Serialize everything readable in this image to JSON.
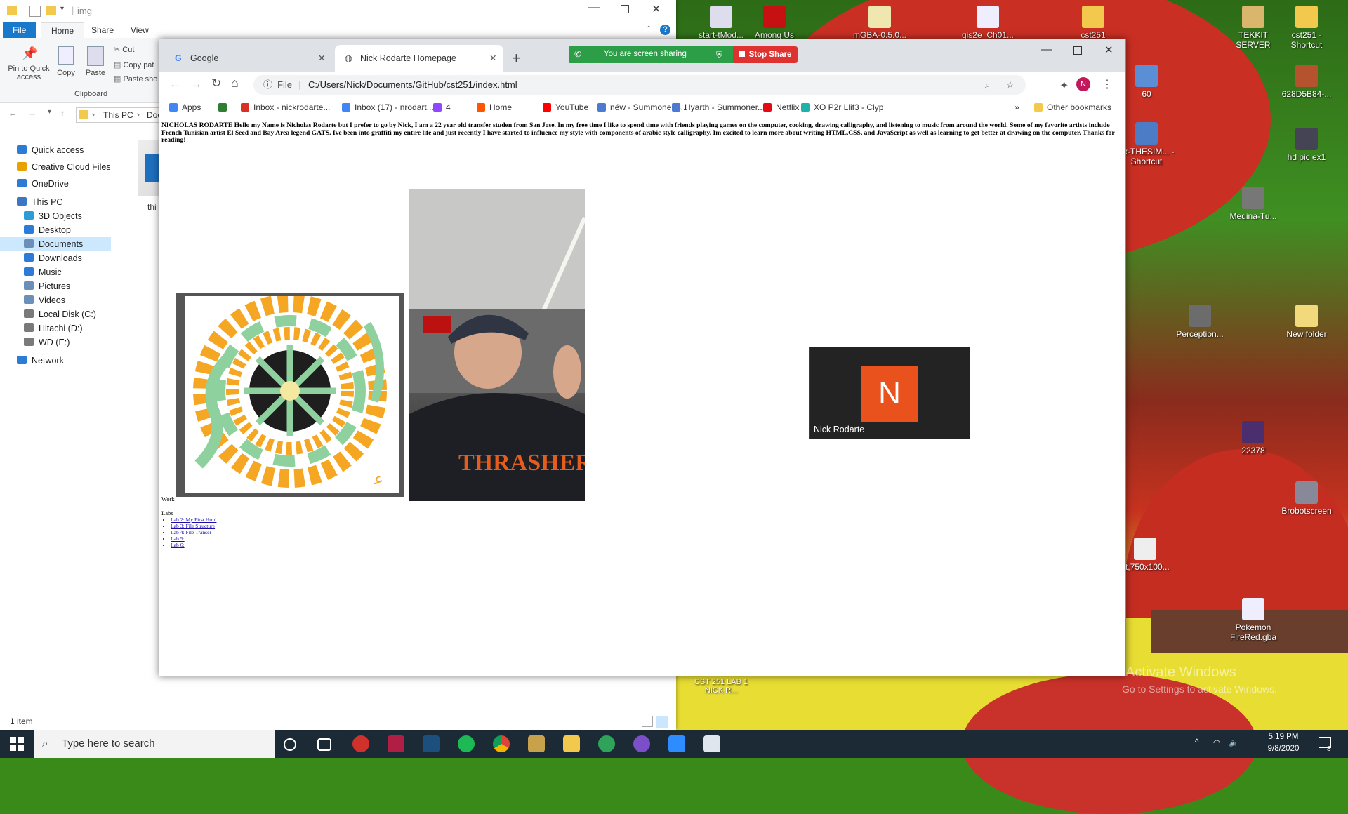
{
  "explorer": {
    "path_title": "img",
    "tabs": [
      "File",
      "Home",
      "Share",
      "View"
    ],
    "ribbon": {
      "pin_label": "Pin to Quick access",
      "copy_label": "Copy",
      "paste_label": "Paste",
      "cut_label": "Cut",
      "copy_path_label": "Copy pat",
      "paste_shortcut_label": "Paste sho",
      "group_label": "Clipboard"
    },
    "address": {
      "this_pc": "This PC",
      "next": "Doc"
    },
    "nav": [
      {
        "label": "Quick access",
        "color": "#2c7bd6"
      },
      {
        "label": "Creative Cloud Files",
        "color": "#e8a100"
      },
      {
        "label": "OneDrive",
        "color": "#2c7bd6"
      },
      {
        "label": "This PC",
        "color": "#3b78c4"
      },
      {
        "label": "3D Objects",
        "color": "#2d9bd6"
      },
      {
        "label": "Desktop",
        "color": "#2c7bd6"
      },
      {
        "label": "Documents",
        "color": "#6b8fb8"
      },
      {
        "label": "Downloads",
        "color": "#2c7bd6"
      },
      {
        "label": "Music",
        "color": "#2c7bd6"
      },
      {
        "label": "Pictures",
        "color": "#6b8fb8"
      },
      {
        "label": "Videos",
        "color": "#6b8fb8"
      },
      {
        "label": "Local Disk (C:)",
        "color": "#7a7a7a"
      },
      {
        "label": "Hitachi (D:)",
        "color": "#7a7a7a"
      },
      {
        "label": "WD (E:)",
        "color": "#7a7a7a"
      },
      {
        "label": "Network",
        "color": "#2c7bd6"
      }
    ],
    "file_caption": "thi",
    "status_items": "1 item"
  },
  "chrome": {
    "tabs": [
      {
        "title": "Google",
        "active": false
      },
      {
        "title": "Nick Rodarte Homepage",
        "active": true
      }
    ],
    "file_label": "File",
    "url": "C:/Users/Nick/Documents/GitHub/cst251/index.html",
    "profile_initial": "N",
    "bookmarks": [
      {
        "label": "Apps",
        "color": "#4285f4"
      },
      {
        "label": "",
        "color": "#2e7d32"
      },
      {
        "label": "Inbox - nickrodarte...",
        "color": "#d93025"
      },
      {
        "label": "Inbox (17) - nrodart...",
        "color": "#4285f4"
      },
      {
        "label": "4",
        "color": "#9146ff"
      },
      {
        "label": "Home",
        "color": "#ff5500"
      },
      {
        "label": "YouTube",
        "color": "#ff0000"
      },
      {
        "label": "néw - Summoner s...",
        "color": "#4a7bd0"
      },
      {
        "label": "Hyarth - Summoner...",
        "color": "#4a7bd0"
      },
      {
        "label": "Netflix",
        "color": "#e50914"
      },
      {
        "label": "XO P2r Llif3 - Clyp",
        "color": "#20b2aa"
      }
    ],
    "other_bookmarks": "Other bookmarks"
  },
  "page": {
    "intro": "NICHOLAS RODARTE Hello my Name is Nicholas Rodarte but I prefer to go by Nick, I am a 22 year old transfer studen from San Jose. In my free time I like to spend time with friends playing games on the computer, cooking, drawing calligraphy, and listening to music from around the world. Some of my favorite artists include French Tunisian artist El Seed and Bay Area legend GATS. Ive been into graffiti my entire life and just recently I have started to influence my style with components of arabic style calligraphy. Im excited to learn more about writing HTML,CSS, and JavaScript as well as learning to get better at drawing on the computer. Thanks for reading!",
    "work_label": "Work",
    "labs_label": "Labs",
    "labs": [
      "Lab 2: My First Html",
      "Lab 3: File Structure",
      "Lab 4: File Transer",
      "Lab 5:",
      "Lab 6:"
    ]
  },
  "screenshare": {
    "status": "You are screen sharing",
    "stop": "Stop Share"
  },
  "zoom": {
    "initial": "N",
    "name": "Nick Rodarte"
  },
  "desktop_icons": [
    "start-tMod...",
    "Among Us",
    "mGBA-0.5.0...",
    "gis2e_Ch01...",
    "cst251",
    "TEKKIT SERVER",
    "cst251 - Shortcut",
    "60",
    "628D5B84-...",
    "ox-THESIM... - Shortcut",
    "hd pic ex1",
    "Medina-Tu...",
    "Perception...",
    "New folder",
    "22378",
    "Brobotscreen",
    "at,750x100...",
    "Pokemon FireRed.gba",
    "CST 251 LAB 1 NICK R..."
  ],
  "watermark": {
    "line1": "Activate Windows",
    "line2": "Go to Settings to activate Windows."
  },
  "taskbar": {
    "search_placeholder": "Type here to search",
    "time": "5:19 PM",
    "date": "9/8/2020",
    "notifications": "8"
  }
}
